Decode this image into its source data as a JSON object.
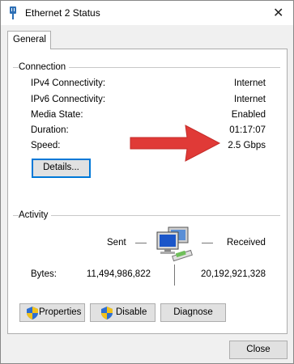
{
  "window": {
    "title": "Ethernet 2 Status"
  },
  "tabs": [
    {
      "label": "General"
    }
  ],
  "connection": {
    "section_label": "Connection",
    "rows": [
      {
        "label": "IPv4 Connectivity:",
        "value": "Internet"
      },
      {
        "label": "IPv6 Connectivity:",
        "value": "Internet"
      },
      {
        "label": "Media State:",
        "value": "Enabled"
      },
      {
        "label": "Duration:",
        "value": "01:17:07"
      },
      {
        "label": "Speed:",
        "value": "2.5 Gbps"
      }
    ],
    "details_button": "Details..."
  },
  "activity": {
    "section_label": "Activity",
    "sent_label": "Sent",
    "received_label": "Received",
    "bytes_label": "Bytes:",
    "bytes_sent": "11,494,986,822",
    "bytes_received": "20,192,921,328"
  },
  "buttons": {
    "properties": "Properties",
    "disable": "Disable",
    "diagnose": "Diagnose",
    "close": "Close"
  },
  "icons": {
    "title": "network-adapter-icon",
    "network": "network-computers-icon",
    "shield": "uac-shield-icon",
    "arrow": "red-arrow-annotation"
  },
  "colors": {
    "arrow": "#e03a37",
    "focus": "#0078d7"
  }
}
